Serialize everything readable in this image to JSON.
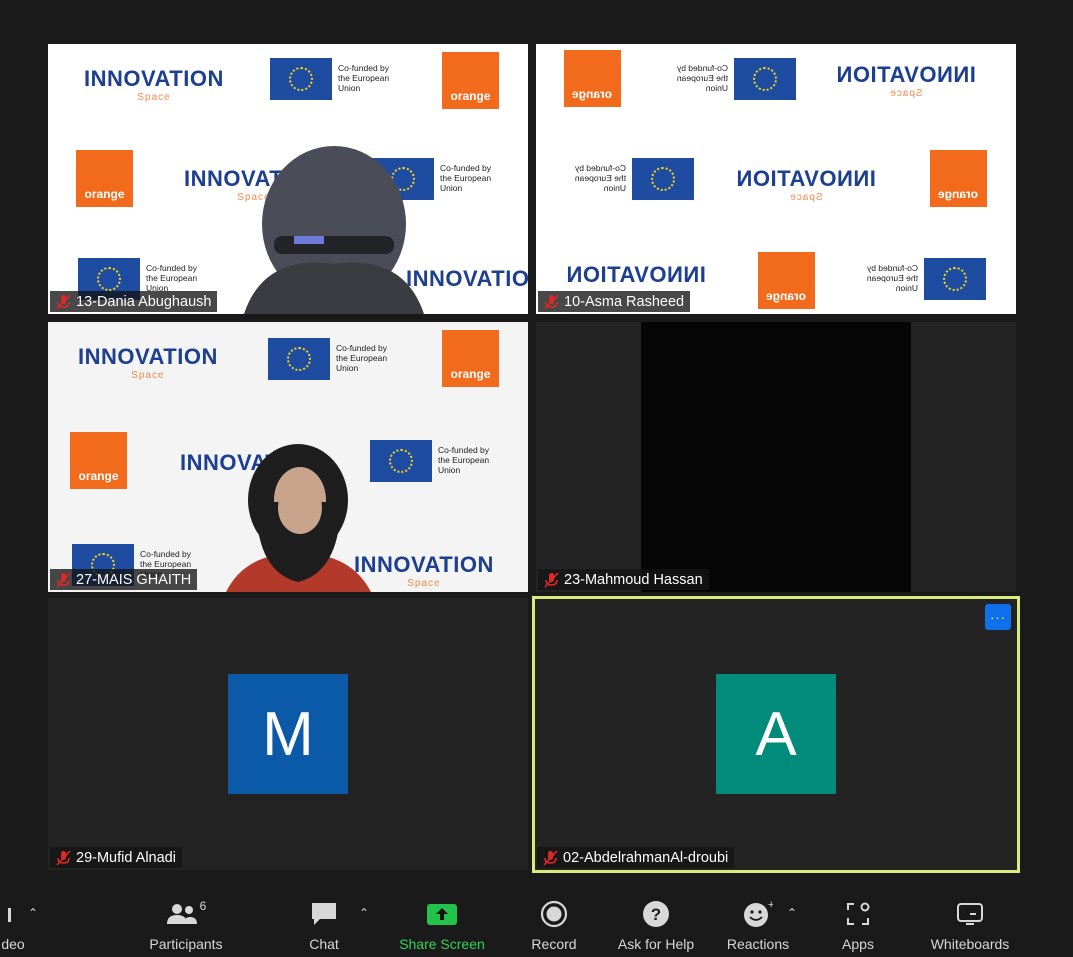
{
  "participants_tiles": [
    {
      "name": "13-Dania Abughaush"
    },
    {
      "name": "10-Asma Rasheed"
    },
    {
      "name": "27-MAIS GHAITH"
    },
    {
      "name": "23-Mahmoud Hassan"
    },
    {
      "name": "29-Mufid Alnadi",
      "avatar_letter": "M",
      "avatar_color": "#0a5aa8"
    },
    {
      "name": "02-AbdelrahmanAl-droubi",
      "avatar_letter": "A",
      "avatar_color": "#008b7a",
      "active_speaker": true,
      "more_label": "···"
    }
  ],
  "backdrop": {
    "innovation": "INNOVATION",
    "space": "Space",
    "orange": "orange",
    "eu_text": "Co-funded by the European Union"
  },
  "toolbar": {
    "video_label": "deo",
    "participants_label": "Participants",
    "participants_count": "6",
    "chat_label": "Chat",
    "share_label": "Share Screen",
    "record_label": "Record",
    "help_label": "Ask for Help",
    "reactions_label": "Reactions",
    "apps_label": "Apps",
    "whiteboards_label": "Whiteboards"
  },
  "colors": {
    "active_border": "#d7ec7c",
    "share_green": "#33d15a",
    "accent_blue": "#0e71eb"
  }
}
